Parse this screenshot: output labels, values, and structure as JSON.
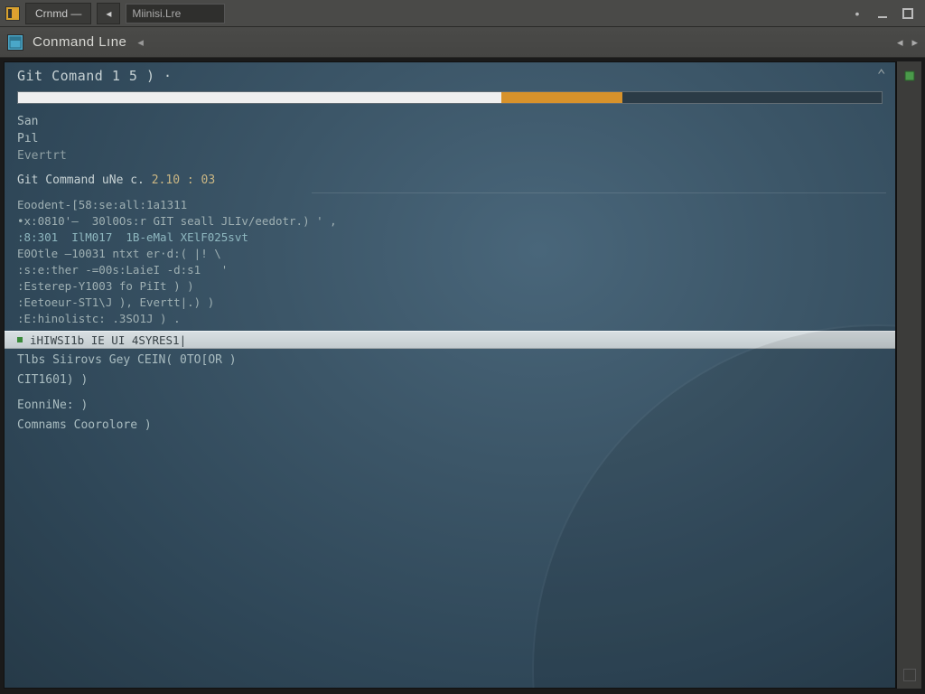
{
  "titlebar": {
    "tab1_label": "Crnmd —",
    "tab_nav_glyph": "◂",
    "input_value": "Miinisi.Lre"
  },
  "toolbar": {
    "title": "Conmand Lıne",
    "back_glyph": "◂",
    "nav_prev": "◂",
    "nav_next": "▸"
  },
  "pane": {
    "header": "Git Comand  1 5 ) ·",
    "progress_white_pct": "56%",
    "progress_orange_pct": "14%"
  },
  "quick": {
    "l1": "San",
    "l2": "Pıl",
    "l3": "Evertrt"
  },
  "version_line": {
    "prefix": "Git Command uNe  c.",
    "ver": "2.10 : 03"
  },
  "code": {
    "c1": "Eoodent-[58:se:all:1a1311",
    "c2": "•x:0810'—  30l0Os:r GIT seall JLIv/eedotr.) ' ,",
    "c3": ":8:301  IlM017  1B-eMal XElF025svt  ",
    "c4": "E0Otle —10031 ntxt er·d:( |! \\",
    "c5": ":s:e:ther -=00s:LaieI -d:s1   '",
    "c6": ":Esterep-Y1003 fo PiIt ) )",
    "c7": ":Eetoeur-ST1\\J ), Evertt|.) )",
    "c8": ":E:hinolistc: .3SO1J ) ."
  },
  "selected_line": "iHIWSI1b IE UI 4SYRES1|",
  "lower": {
    "l1": "Tlbs Siirovs Gey CEIN( 0TO[OR )",
    "l2": "CIT1601) )",
    "l3": "EonniNe: )",
    "l4": "Comnams Coorolore )"
  }
}
